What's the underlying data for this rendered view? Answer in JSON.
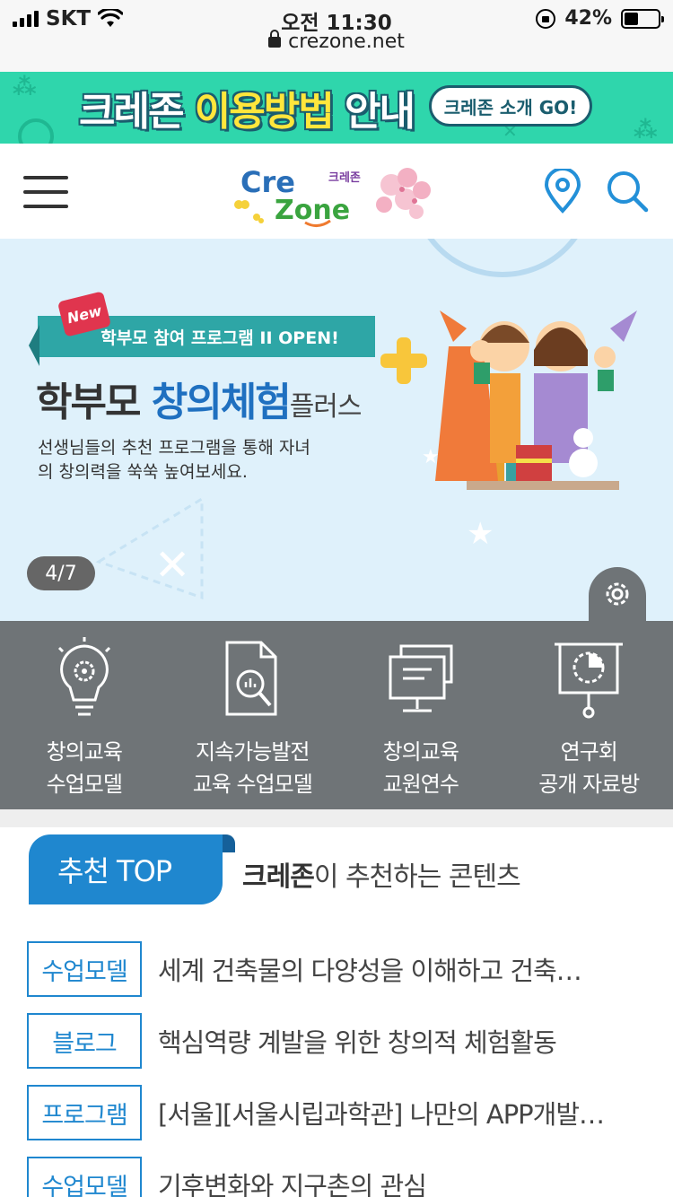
{
  "status_bar": {
    "carrier": "SKT",
    "time": "오전 11:30",
    "url": "crezone.net",
    "battery": "42%",
    "battery_level": 0.42
  },
  "promo": {
    "title_part1": "크레존 ",
    "title_highlight": "이용방법",
    "title_part2": " 안내",
    "button": "크레존 소개 GO!"
  },
  "header": {
    "logo_cre": "Cre",
    "logo_zone": "Zone",
    "logo_kr": "크레존"
  },
  "hero": {
    "badge": "New",
    "ribbon": "학부모 참여 프로그램 II OPEN!",
    "title_a": "학부모 ",
    "title_b": "창의체험",
    "title_c": "플러스",
    "subtitle": "선생님들의 추천 프로그램을 통해 자녀의 창의력을 쑥쑥 높여보세요.",
    "indicator": "4/7"
  },
  "quick_menu": [
    {
      "label": "창의교육\n수업모델",
      "icon": "lightbulb-gear-icon"
    },
    {
      "label": "지속가능발전\n교육 수업모델",
      "icon": "document-search-icon"
    },
    {
      "label": "창의교육\n교원연수",
      "icon": "monitor-icon"
    },
    {
      "label": "연구회\n공개 자료방",
      "icon": "presentation-chart-icon"
    }
  ],
  "recommend": {
    "tab": "추천 TOP",
    "desc_bold": "크레존",
    "desc_rest": "이 추천하는 콘텐츠",
    "items": [
      {
        "category": "수업모델",
        "title": "세계 건축물의 다양성을 이해하고 건축…"
      },
      {
        "category": "블로그",
        "title": "핵심역량 계발을 위한 창의적 체험활동"
      },
      {
        "category": "프로그램",
        "title": "[서울][서울시립과학관] 나만의 APP개발…"
      },
      {
        "category": "수업모델",
        "title": "기후변화와 지구촌의 관심"
      }
    ]
  },
  "colors": {
    "promo_bg": "#2fd6ac",
    "hero_bg": "#dff1fb",
    "quickmenu_bg": "#6f7477",
    "accent_blue": "#1f87cf"
  }
}
